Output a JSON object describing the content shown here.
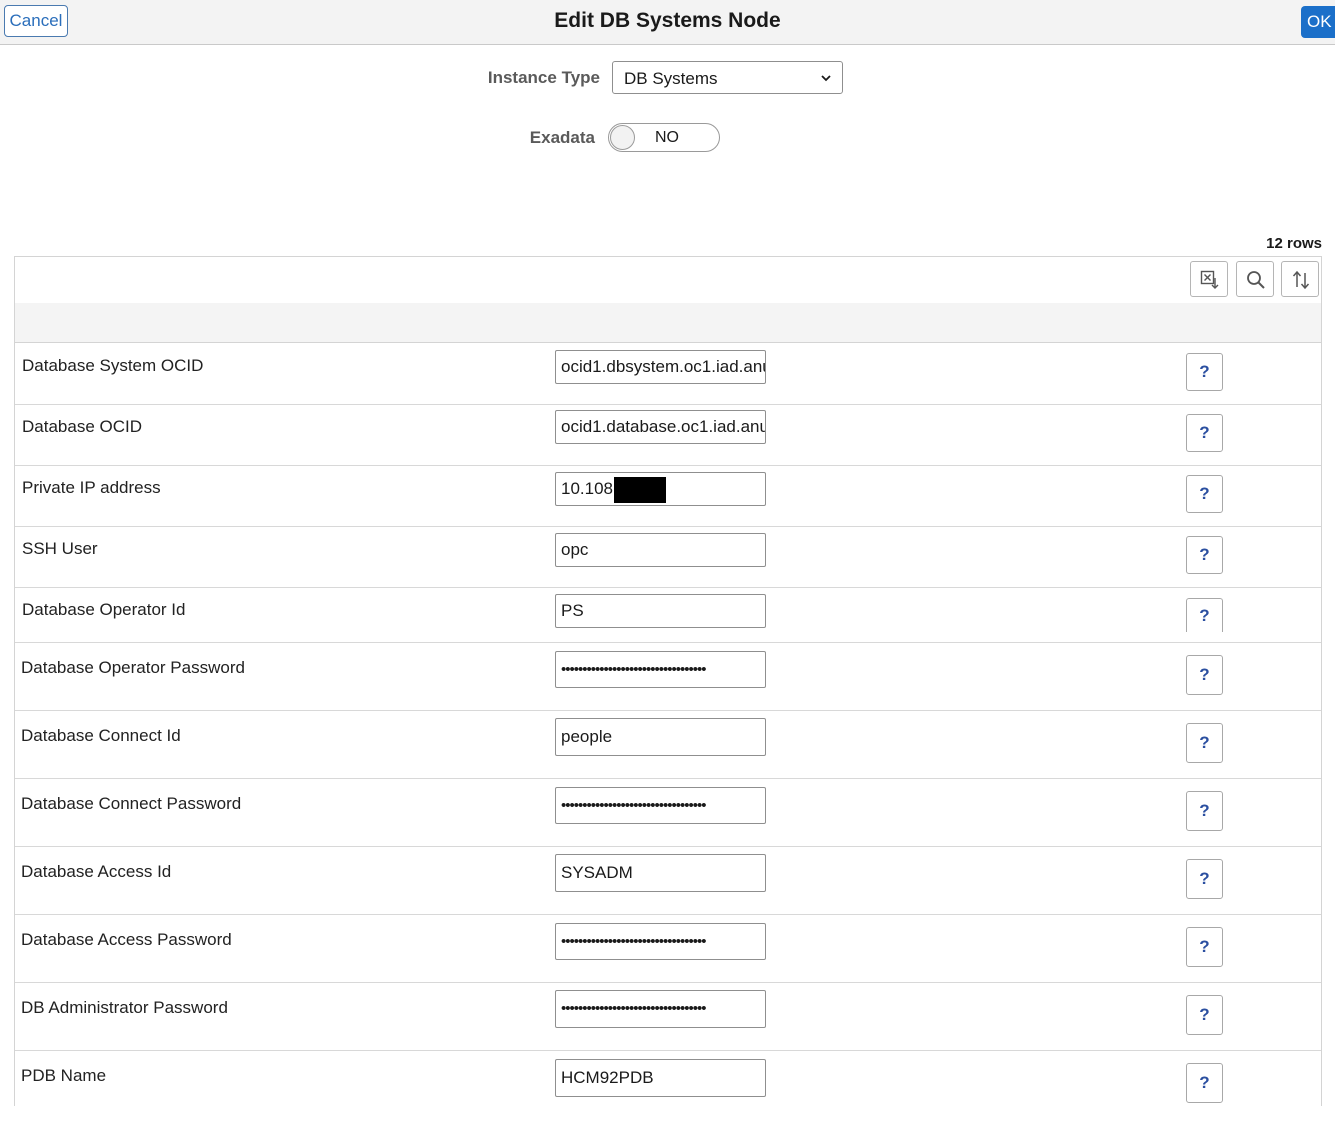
{
  "header": {
    "cancel_label": "Cancel",
    "title": "Edit DB Systems Node",
    "ok_label": "OK"
  },
  "form": {
    "instance_type_label": "Instance Type",
    "instance_type_value": "DB Systems",
    "exadata_label": "Exadata",
    "exadata_value": "NO"
  },
  "grid": {
    "row_count": "12 rows",
    "toolbar": [
      "download-excel-icon",
      "search-icon",
      "sort-icon"
    ],
    "help_label": "?",
    "rows": [
      {
        "label": "Database System OCID",
        "value": "ocid1.dbsystem.oc1.iad.anu"
      },
      {
        "label": "Database OCID",
        "value": "ocid1.database.oc1.iad.anu"
      },
      {
        "label": "Private IP address",
        "value": "10.108"
      },
      {
        "label": "SSH User",
        "value": "opc"
      },
      {
        "label": "Database Operator Id",
        "value": "PS"
      },
      {
        "label": "Database Operator Password",
        "value": "••••••••••••••••••••••••••••••••••"
      },
      {
        "label": "Database Connect Id",
        "value": "people"
      },
      {
        "label": "Database Connect Password",
        "value": "••••••••••••••••••••••••••••••••••"
      },
      {
        "label": "Database Access Id",
        "value": "SYSADM"
      },
      {
        "label": "Database Access Password",
        "value": "••••••••••••••••••••••••••••••••••"
      },
      {
        "label": "DB Administrator Password",
        "value": "••••••••••••••••••••••••••••••••••"
      },
      {
        "label": "PDB Name",
        "value": "HCM92PDB"
      }
    ]
  },
  "colors": {
    "accent": "#1b6fc9",
    "help_text": "#2b4fa0",
    "label_gray": "#5a5a5a"
  }
}
